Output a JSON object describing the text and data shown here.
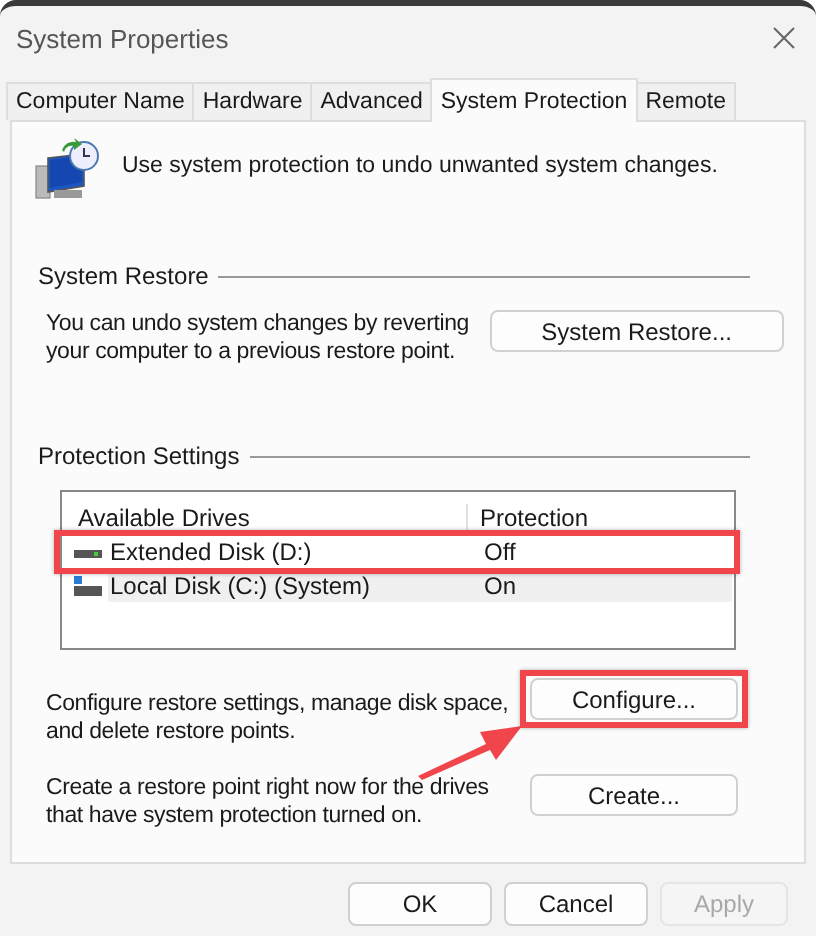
{
  "window": {
    "title": "System Properties"
  },
  "tabs": [
    {
      "label": "Computer Name",
      "selected": false
    },
    {
      "label": "Hardware",
      "selected": false
    },
    {
      "label": "Advanced",
      "selected": false
    },
    {
      "label": "System Protection",
      "selected": true
    },
    {
      "label": "Remote",
      "selected": false
    }
  ],
  "intro": "Use system protection to undo unwanted system changes.",
  "system_restore": {
    "heading": "System Restore",
    "text": "You can undo system changes by reverting your computer to a previous restore point.",
    "button": "System Restore..."
  },
  "protection_settings": {
    "heading": "Protection Settings",
    "columns": [
      "Available Drives",
      "Protection"
    ],
    "drives": [
      {
        "name": "Extended Disk (D:)",
        "protection": "Off",
        "kind": "extended",
        "selected": false,
        "annotated": true
      },
      {
        "name": "Local Disk (C:) (System)",
        "protection": "On",
        "kind": "system",
        "selected": true,
        "annotated": false
      }
    ],
    "configure": {
      "text": "Configure restore settings, manage disk space, and delete restore points.",
      "button": "Configure...",
      "annotated": true
    },
    "create": {
      "text": "Create a restore point right now for the drives that have system protection turned on.",
      "button": "Create..."
    }
  },
  "buttons": [
    {
      "label": "OK",
      "disabled": false
    },
    {
      "label": "Cancel",
      "disabled": false
    },
    {
      "label": "Apply",
      "disabled": true
    }
  ]
}
